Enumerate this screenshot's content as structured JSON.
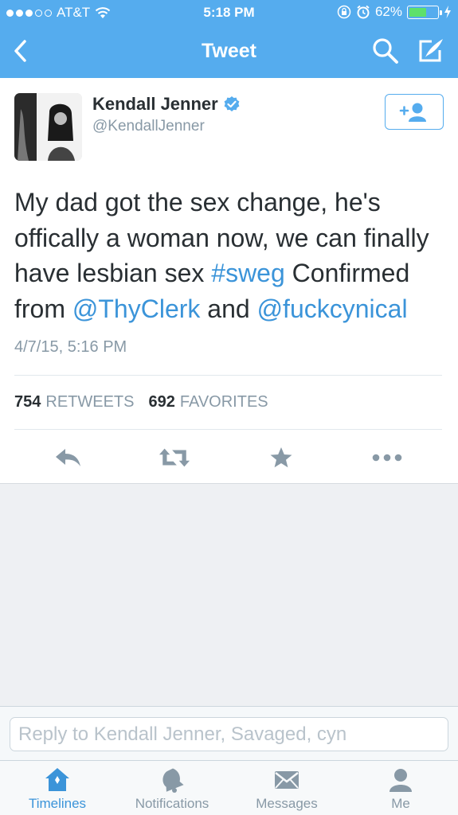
{
  "status_bar": {
    "carrier": "AT&T",
    "time": "5:18 PM",
    "battery": "62%",
    "battery_level": 0.62
  },
  "nav": {
    "title": "Tweet",
    "icons": [
      "back-chevron-icon",
      "search-icon",
      "compose-icon"
    ]
  },
  "tweet": {
    "author_name": "Kendall Jenner",
    "author_handle": "@KendallJenner",
    "verified": true,
    "text_parts": [
      "My dad got the sex change, he's offically a woman now, we can finally have lesbian sex ",
      "#sweg",
      " Confirmed from ",
      "@ThyClerk",
      " and ",
      "@fuckcynical"
    ],
    "timestamp": "4/7/15, 5:16 PM",
    "retweets_count": "754",
    "retweets_label": "RETWEETS",
    "favorites_count": "692",
    "favorites_label": "FAVORITES"
  },
  "actions": [
    "reply-icon",
    "retweet-icon",
    "favorite-icon",
    "more-icon"
  ],
  "reply": {
    "placeholder": "Reply to Kendall Jenner, Savaged, cyn"
  },
  "tabs": [
    {
      "label": "Timelines",
      "icon": "home-icon",
      "active": true
    },
    {
      "label": "Notifications",
      "icon": "bell-icon",
      "active": false
    },
    {
      "label": "Messages",
      "icon": "envelope-icon",
      "active": false
    },
    {
      "label": "Me",
      "icon": "person-icon",
      "active": false
    }
  ],
  "colors": {
    "brand_blue": "#55acee",
    "link_blue": "#3b94d9",
    "muted_gray": "#8899a6",
    "icon_gray": "#8899a6"
  }
}
